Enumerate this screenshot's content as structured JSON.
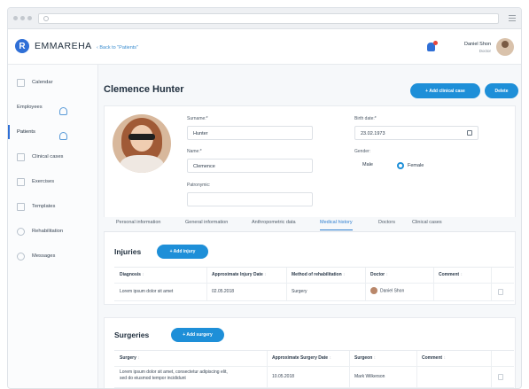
{
  "app": {
    "name": "EMMAREHA",
    "logo_letter": "R"
  },
  "topbar": {
    "back_label": "‹ Back to \"Patients\"",
    "user_name": "Daniel Shon",
    "user_role": "Doctor"
  },
  "sidebar": {
    "items": [
      {
        "label": "Calendar"
      },
      {
        "label": "Employees"
      },
      {
        "label": "Patients"
      },
      {
        "label": "Clinical cases"
      },
      {
        "label": "Exercises"
      },
      {
        "label": "Templates"
      },
      {
        "label": "Rehabilitation"
      },
      {
        "label": "Messages"
      }
    ],
    "active": "Patients"
  },
  "patient": {
    "title": "Clemence Hunter",
    "add_case_label": "+ Add clinical case",
    "delete_label": "Delete",
    "surname_label": "Surname:*",
    "surname_value": "Hunter",
    "name_label": "Name:*",
    "name_value": "Clemence",
    "patronymic_label": "Patronymic:",
    "patronymic_value": "",
    "birth_label": "Birth date:*",
    "birth_value": "23.02.1973",
    "gender_label": "Gender:",
    "gender_options": [
      "Male",
      "Female"
    ],
    "gender_selected": "Female"
  },
  "tabs": [
    "Personal information",
    "General information",
    "Anthropometric data",
    "Medical history",
    "Doctors",
    "Clinical cases"
  ],
  "active_tab": "Medical history",
  "injuries": {
    "title": "Injuries",
    "add_label": "+ Add injury",
    "columns": [
      "Diagnosis",
      "Approximate Injury Date",
      "Method of rehabilitation",
      "Doctor",
      "Comment"
    ],
    "rows": [
      {
        "diagnosis": "Lorem ipsum dolor sit amet",
        "date": "02.05.2018",
        "method": "Surgery",
        "doctor": "Daniel Shon",
        "comment": ""
      }
    ]
  },
  "surgeries": {
    "title": "Surgeries",
    "add_label": "+ Add surgery",
    "columns": [
      "Surgery",
      "Approximate Surgery Date",
      "Surgeon",
      "Comment"
    ],
    "rows": [
      {
        "surgery_line1": "Lorem ipsum dolor sit amet, consectetur adipiscing elit,",
        "surgery_line2": "sed do eiusmod tempor incididunt",
        "date": "10.05.2018",
        "surgeon": "Mark Wilkerson",
        "comment": ""
      }
    ]
  },
  "colors": {
    "accent": "#1e8fd8",
    "brand": "#2f6fd6",
    "badge": "#e9463b"
  }
}
